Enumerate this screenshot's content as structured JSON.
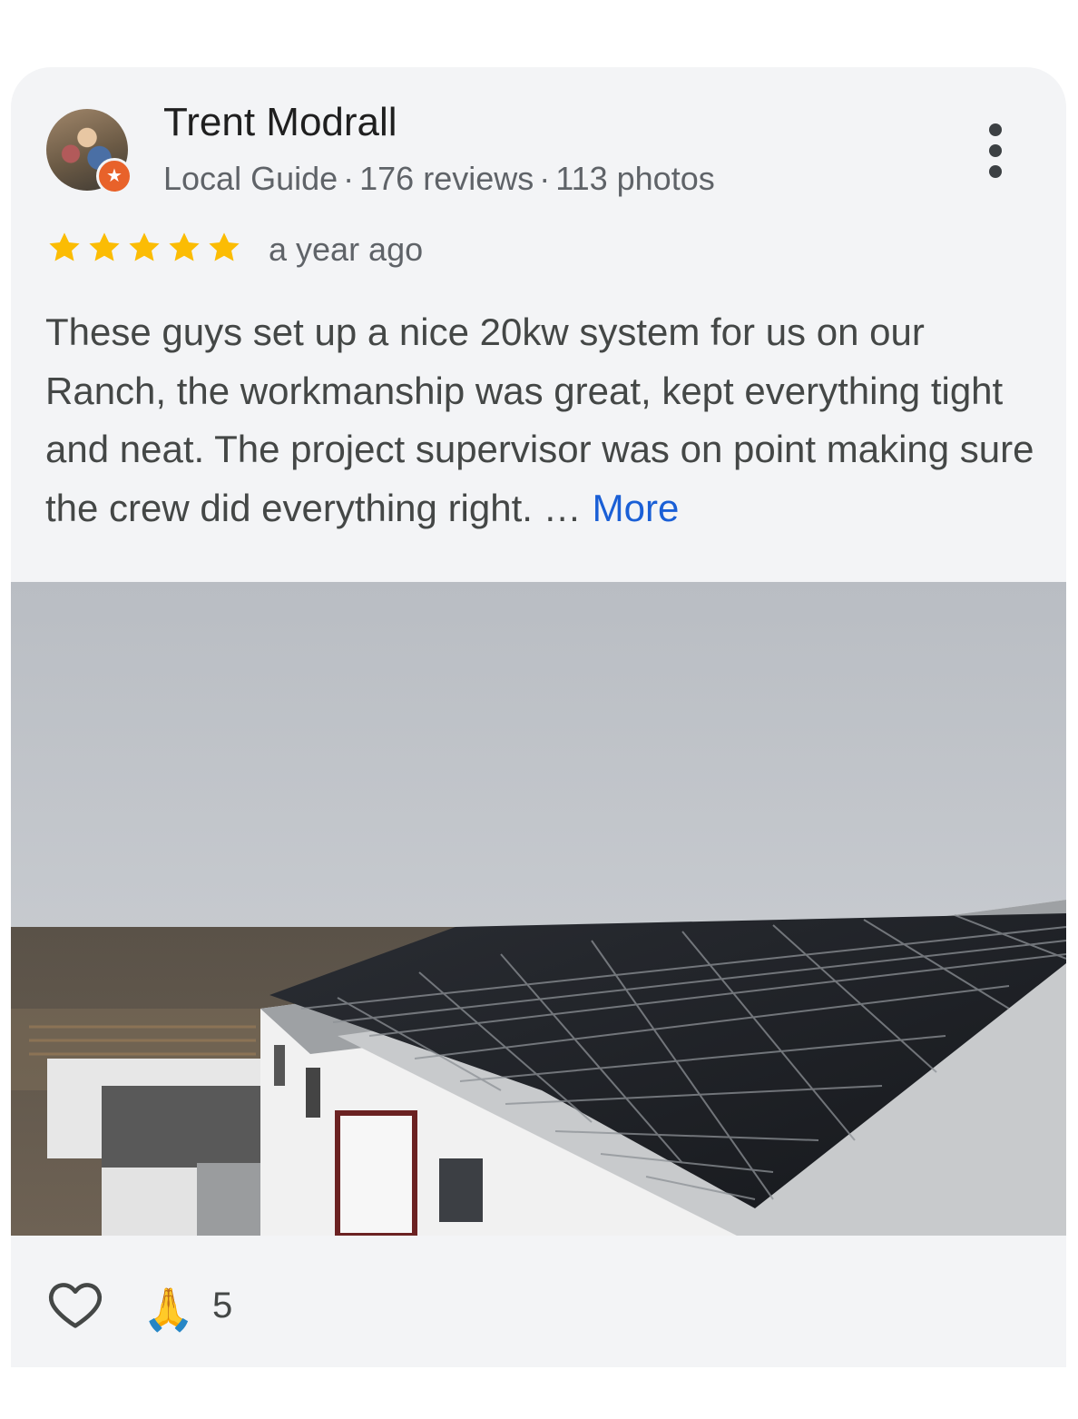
{
  "review": {
    "author_name": "Trent Modrall",
    "author_badge": "Local Guide",
    "author_reviews": "176 reviews",
    "author_photos": "113 photos",
    "separator": "·",
    "rating": 5,
    "rating_max": 5,
    "time_ago": "a year ago",
    "text": "These guys set up a nice 20kw system for us on our Ranch, the workmanship was great, kept everything tight and neat. The project supervisor was on point making sure the crew did everything right. …",
    "more_label": "More",
    "reaction_emoji": "🙏",
    "reaction_count": "5"
  },
  "colors": {
    "card_background": "#f3f4f6",
    "star": "#fbbc04",
    "link": "#1a5fd6",
    "guide_badge": "#e8622a"
  },
  "icons": {
    "menu": "more-vert-icon",
    "like": "heart-outline-icon",
    "badge": "local-guide-star-icon"
  }
}
